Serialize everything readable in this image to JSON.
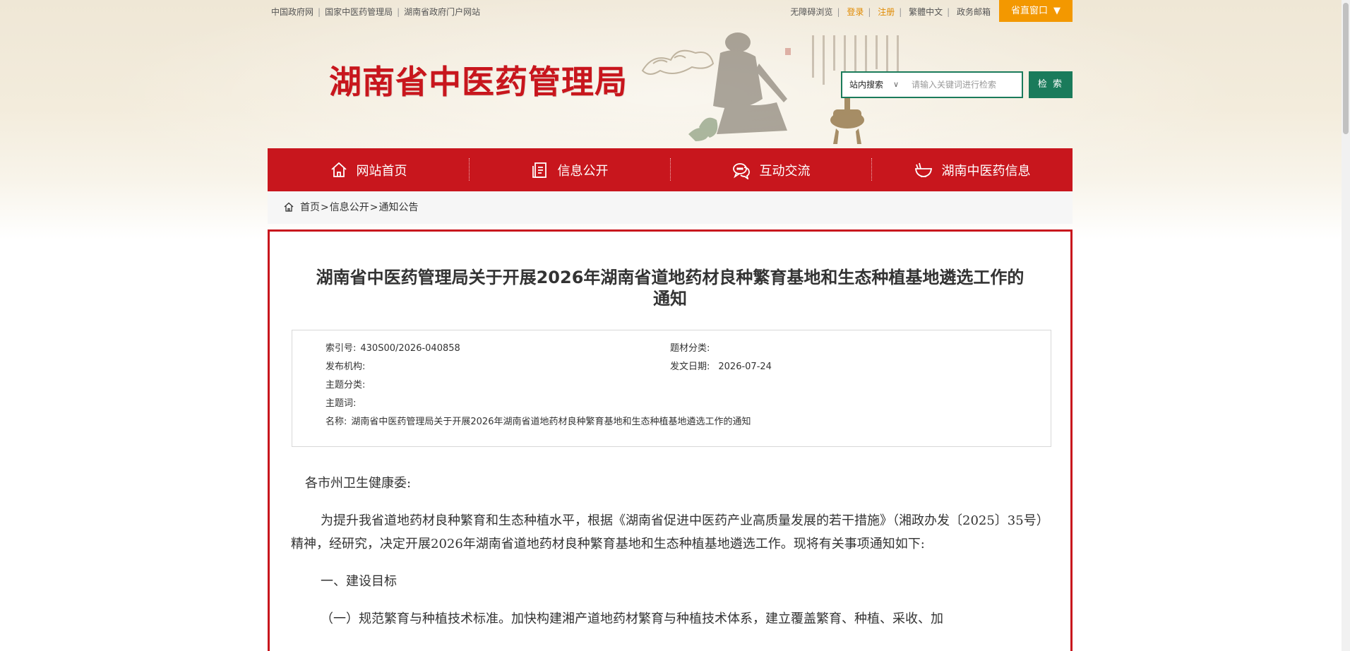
{
  "topbar": {
    "links_left": [
      "中国政府网",
      "国家中医药管理局",
      "湖南省政府门户网站"
    ],
    "accessibility": "无障碍浏览",
    "login": "登录",
    "register": "注册",
    "traditional": "繁體中文",
    "mailbox": "政务邮箱",
    "window_label": "省直窗口",
    "window_arrow": "▼"
  },
  "header": {
    "logo_text": "湖南省中医药管理局"
  },
  "search": {
    "scope": "站内搜索",
    "placeholder": "请输入关键词进行检索",
    "button": "检 索"
  },
  "nav": {
    "items": [
      {
        "label": "网站首页",
        "icon": "home-icon"
      },
      {
        "label": "信息公开",
        "icon": "document-icon"
      },
      {
        "label": "互动交流",
        "icon": "chat-icon"
      },
      {
        "label": "湖南中医药信息",
        "icon": "bowl-icon"
      }
    ]
  },
  "breadcrumb": {
    "items": [
      "首页",
      "信息公开",
      "通知公告"
    ],
    "separator": ">"
  },
  "article": {
    "title_line1": "湖南省中医药管理局关于开展2026年湖南省道地药材良种繁育基地和生态种植基地遴选工作的",
    "title_line2": "通知",
    "meta": {
      "index_label": "索引号:",
      "index_value": "430S00/2026-040858",
      "material_label": "题材分类:",
      "material_value": "",
      "issuer_label": "发布机构:",
      "issuer_value": "",
      "date_label": "发文日期:",
      "date_value": "2026-07-24",
      "topic_label": "主题分类:",
      "topic_value": "",
      "keywords_label": "主题词:",
      "keywords_value": "",
      "name_label": "名称:",
      "name_value": "湖南省中医药管理局关于开展2026年湖南省道地药材良种繁育基地和生态种植基地遴选工作的通知"
    },
    "paragraphs": [
      "各市州卫生健康委:",
      "为提升我省道地药材良种繁育和生态种植水平，根据《湖南省促进中医药产业高质量发展的若干措施》（湘政办发〔2025〕35号）精神，经研究，决定开展2026年湖南省道地药材良种繁育基地和生态种植基地遴选工作。现将有关事项通知如下:",
      "一、建设目标",
      "（一）规范繁育与种植技术标准。加快构建湘产道地药材繁育与种植技术体系，建立覆盖繁育、种植、采收、加"
    ]
  },
  "colors": {
    "brand_red": "#c8161d",
    "search_green": "#1a7b5b",
    "window_orange": "#f39800"
  }
}
